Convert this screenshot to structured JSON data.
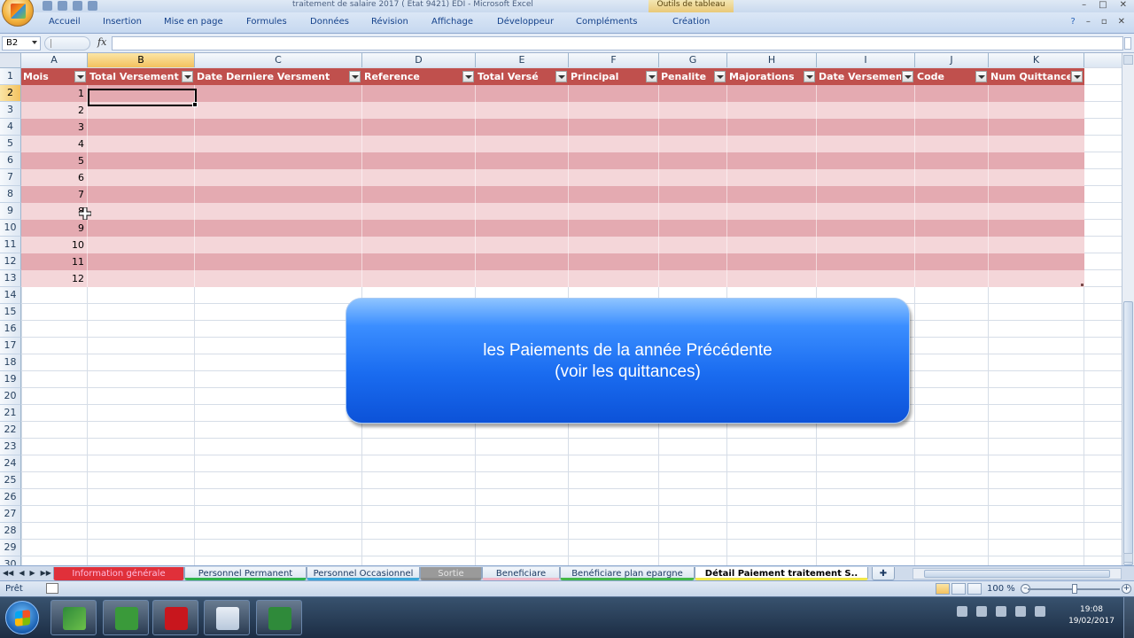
{
  "window": {
    "title": "traitement de salaire 2017 ( Etat 9421) EDI - Microsoft Excel",
    "context_tab": "Outils de tableau"
  },
  "ribbon": {
    "tabs": [
      "Accueil",
      "Insertion",
      "Mise en page",
      "Formules",
      "Données",
      "Révision",
      "Affichage",
      "Développeur",
      "Compléments",
      "Création"
    ]
  },
  "formula_bar": {
    "cell_ref": "B2",
    "fx": "fx",
    "value": ""
  },
  "grid": {
    "columns": [
      "A",
      "B",
      "C",
      "D",
      "E",
      "F",
      "G",
      "H",
      "I",
      "J",
      "K"
    ],
    "rows": [
      "1",
      "2",
      "3",
      "4",
      "5",
      "6",
      "7",
      "8",
      "9",
      "10",
      "11",
      "12",
      "13",
      "14",
      "15",
      "16",
      "17",
      "18",
      "19",
      "20",
      "21",
      "22",
      "23",
      "24",
      "25",
      "26",
      "27",
      "28",
      "29",
      "30"
    ],
    "table_headers": [
      "Mois",
      "Total Versement",
      "Date Derniere Versment",
      "Reference",
      "Total Versé",
      "Principal",
      "Penalite",
      "Majorations",
      "Date Versement",
      "Code",
      "Num Quittance"
    ],
    "mois_values": [
      "1",
      "2",
      "3",
      "4",
      "5",
      "6",
      "7",
      "8",
      "9",
      "10",
      "11",
      "12"
    ],
    "selected_cell": "B2"
  },
  "callout": {
    "line1": "les Paiements de la année Précédente",
    "line2": "(voir les quittances)"
  },
  "sheet_tabs": {
    "tabs": [
      "Information générale",
      "Personnel Permanent",
      "Personnel Occasionnel",
      "Sortie",
      "Beneficiare",
      "Benéficiare plan epargne",
      "Détail Paiement traitement S.."
    ],
    "colors": [
      "#e0303a",
      "#2fb34a",
      "#3aa7d8",
      "#8a8a8a",
      "#f0b8c8",
      "#44b848",
      "#f2e84a"
    ],
    "active": "Détail Paiement traitement S.."
  },
  "status": {
    "ready": "Prêt",
    "zoom": "100 %"
  },
  "taskbar": {
    "time": "19:08",
    "date": "19/02/2017",
    "apps": [
      "excel-app",
      "camtasia-app",
      "camtasia-app",
      "pdf-app",
      "file-app",
      "camtasia-app"
    ]
  },
  "colors": {
    "table_header": "#c0504d",
    "band_dark": "#e4aab1",
    "band_light": "#f4d6d9",
    "callout": "#1a6cf0"
  }
}
